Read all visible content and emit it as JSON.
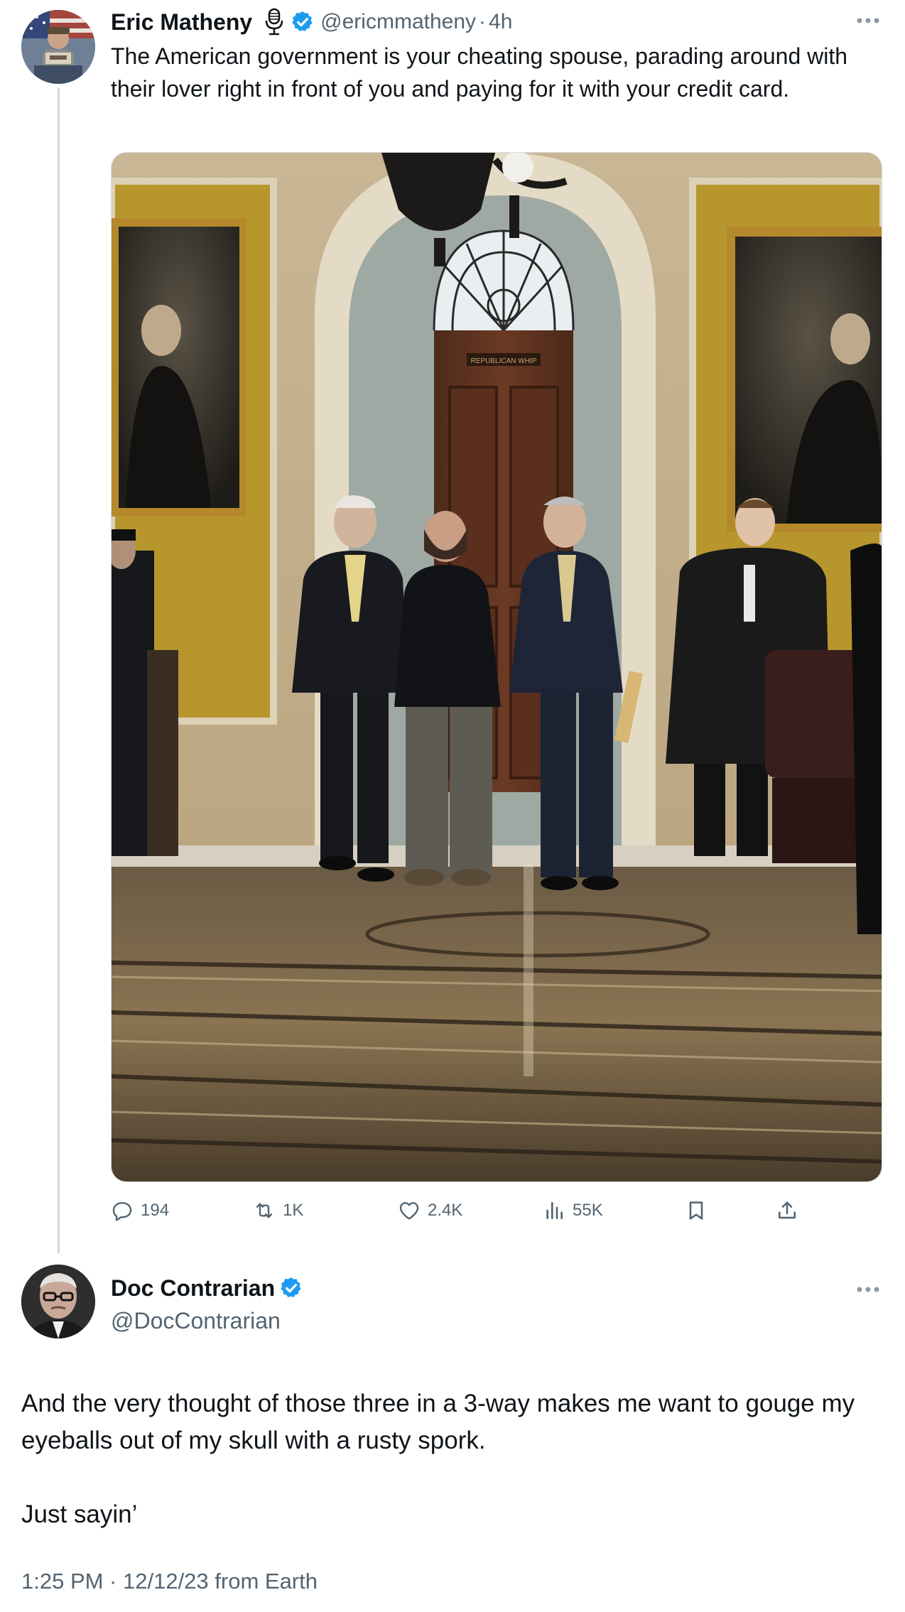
{
  "tweet1": {
    "author_name": "Eric Matheny",
    "handle": "@ericmmatheny",
    "separator": "·",
    "time": "4h",
    "text": "The American government is your cheating spouse, parading around with their lover right in front of you and paying for it with your credit card.",
    "sign_text": "REPUBLICAN WHIP",
    "actions": {
      "replies": "194",
      "reposts": "1K",
      "likes": "2.4K",
      "views": "55K"
    }
  },
  "tweet2": {
    "author_name": "Doc Contrarian",
    "handle": "@DocContrarian",
    "text_line1": "And the very thought of those three in a 3-way makes me want to gouge my eyeballs out of my skull with a rusty spork.",
    "text_line2": "Just sayin’",
    "meta": "1:25 PM · 12/12/23 from Earth"
  },
  "icons": {
    "microphone": "microphone-icon",
    "verified": "verified-badge-icon",
    "more": "more-icon",
    "reply": "reply-icon",
    "repost": "repost-icon",
    "like": "heart-icon",
    "views": "views-icon",
    "bookmark": "bookmark-icon",
    "share": "share-icon"
  },
  "colors": {
    "verified": "#1d9bf0",
    "secondary_text": "#536471",
    "primary_text": "#0f1419",
    "thread_line": "#cfd9de"
  }
}
